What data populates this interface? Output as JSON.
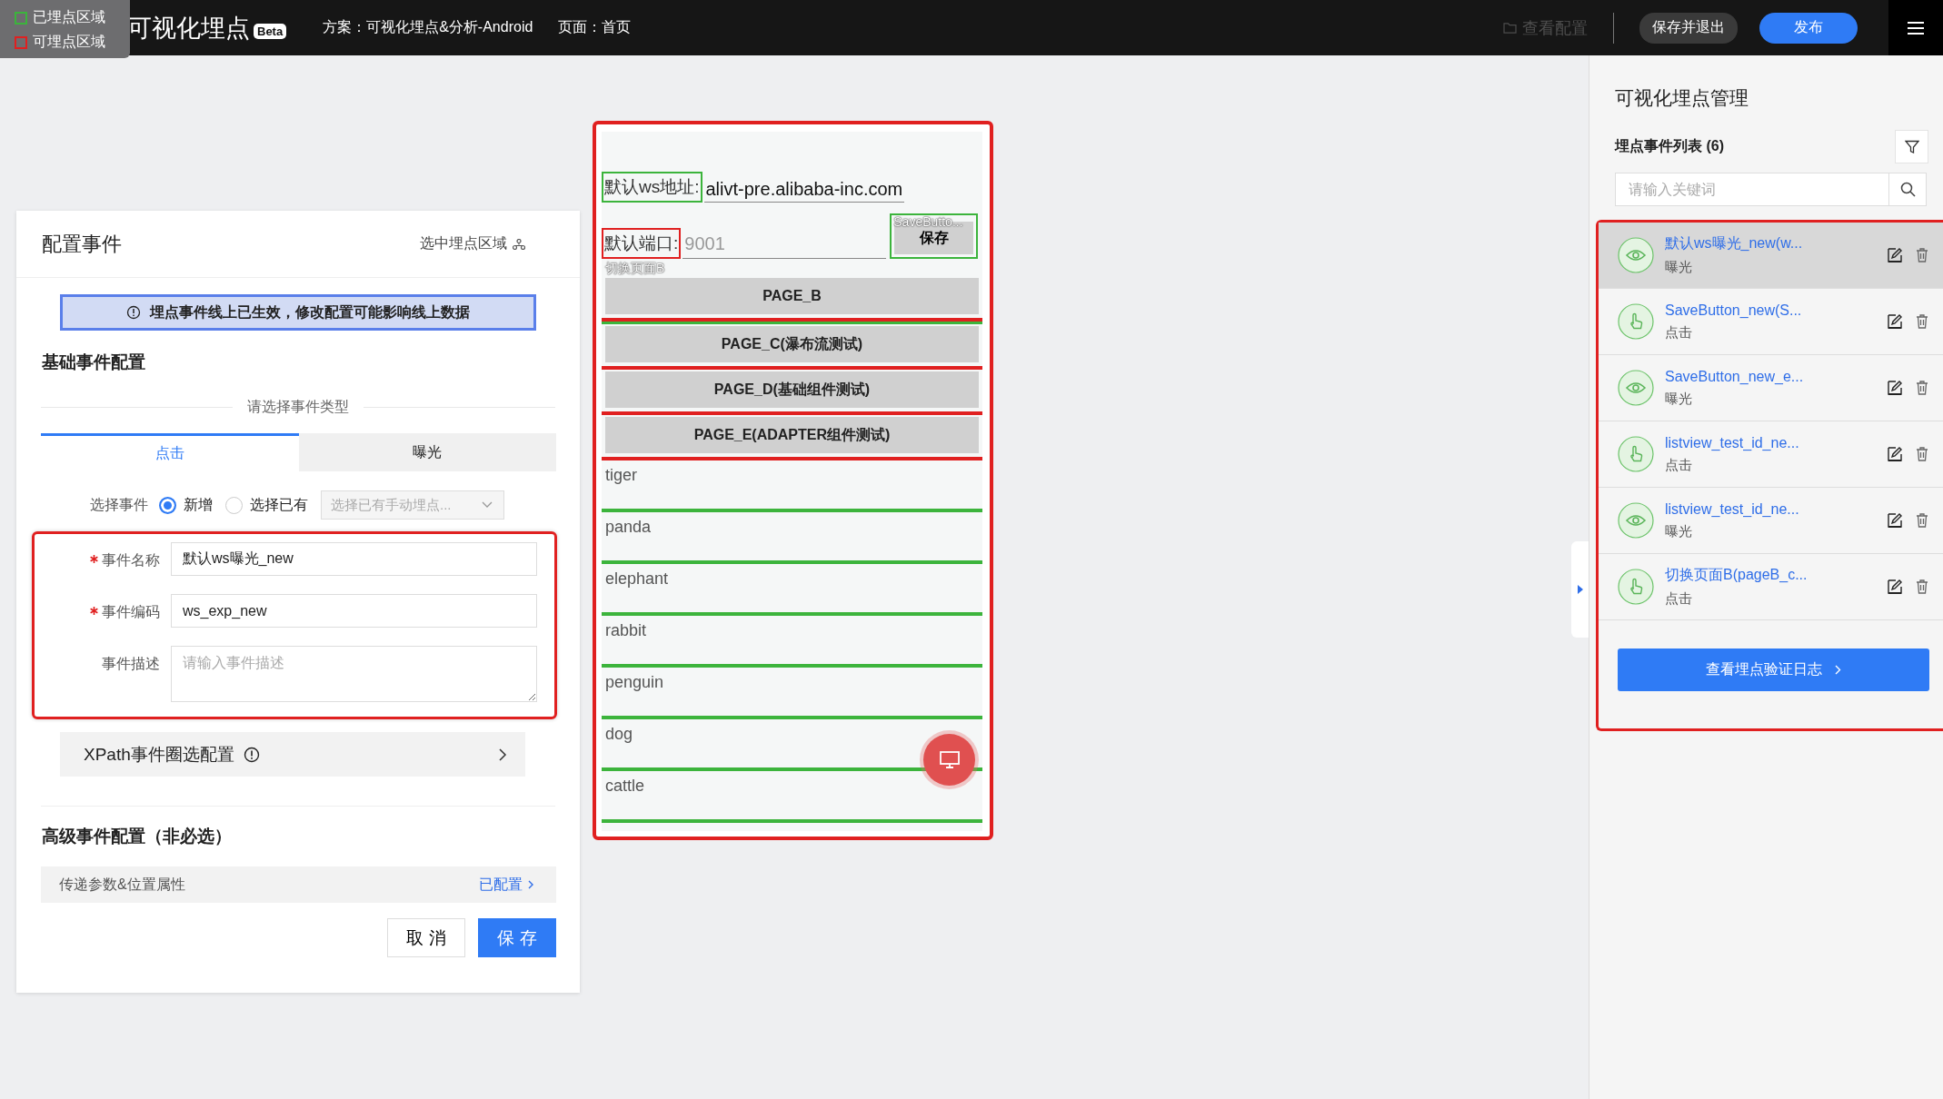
{
  "legend": [
    {
      "label": "已埋点区域",
      "color": "#3cb43c"
    },
    {
      "label": "可埋点区域",
      "color": "#e02020"
    }
  ],
  "topbar": {
    "title": "可视化埋点",
    "badge": "Beta",
    "plan": "方案：可视化埋点&分析-Android",
    "page": "页面：首页",
    "view_config": {
      "label": "查看配置",
      "disabled": true
    },
    "save_exit": "保存并退出",
    "publish": "发布"
  },
  "config_panel": {
    "title": "配置事件",
    "select_area": "选中埋点区域",
    "alert": "埋点事件线上已生效，修改配置可能影响线上数据",
    "basic_section": "基础事件配置",
    "type_divider": "请选择事件类型",
    "tabs": [
      {
        "label": "点击",
        "selected": true
      },
      {
        "label": "曝光",
        "selected": false
      }
    ],
    "select_event": {
      "label": "选择事件",
      "options": [
        {
          "label": "新增",
          "selected": true
        },
        {
          "label": "选择已有",
          "selected": false
        }
      ],
      "dropdown_placeholder": "选择已有手动埋点..."
    },
    "fields": [
      {
        "label": "事件名称",
        "required": true,
        "kind": "input",
        "value": "默认ws曝光_new"
      },
      {
        "label": "事件编码",
        "required": true,
        "kind": "input",
        "value": "ws_exp_new"
      },
      {
        "label": "事件描述",
        "required": false,
        "kind": "textarea",
        "placeholder": "请输入事件描述"
      }
    ],
    "xpath": "XPath事件圈选配置",
    "advanced_section": "高级事件配置（非必选）",
    "params": {
      "label": "传递参数&位置属性",
      "link": "已配置"
    },
    "buttons": {
      "cancel": "取 消",
      "save": "保 存"
    }
  },
  "phone": {
    "address": {
      "label": "默认ws地址:",
      "value": "alivt-pre.alibaba-inc.com",
      "tracked": true
    },
    "port": {
      "label": "默认端口:",
      "placeholder": "9001",
      "tracked": false
    },
    "save_button": {
      "label": "保存",
      "tag": "SaveButto..."
    },
    "page_tag": "切换页面B",
    "page_buttons": [
      {
        "label": "PAGE_B",
        "tracked": true
      },
      {
        "label": "PAGE_C(瀑布流测试)",
        "tracked": false
      },
      {
        "label": "PAGE_D(基础组件测试)",
        "tracked": false
      },
      {
        "label": "PAGE_E(ADAPTER组件测试)",
        "tracked": false
      }
    ],
    "list_items": [
      {
        "label": "tiger",
        "tracked": true
      },
      {
        "label": "panda",
        "tracked": true
      },
      {
        "label": "elephant",
        "tracked": true
      },
      {
        "label": "rabbit",
        "tracked": true
      },
      {
        "label": "penguin",
        "tracked": true
      },
      {
        "label": "dog",
        "tracked": true
      },
      {
        "label": "cattle",
        "tracked": true
      }
    ]
  },
  "manager": {
    "title": "可视化埋点管理",
    "list_title": "埋点事件列表 (6)",
    "search_placeholder": "请输入关键词",
    "events": [
      {
        "name": "默认ws曝光_new(w...",
        "type": "曝光",
        "kind": "exposure",
        "selected": true
      },
      {
        "name": "SaveButton_new(S...",
        "type": "点击",
        "kind": "click",
        "selected": false
      },
      {
        "name": "SaveButton_new_e...",
        "type": "曝光",
        "kind": "exposure",
        "selected": false
      },
      {
        "name": "listview_test_id_ne...",
        "type": "点击",
        "kind": "click",
        "selected": false
      },
      {
        "name": "listview_test_id_ne...",
        "type": "曝光",
        "kind": "exposure",
        "selected": false
      },
      {
        "name": "切换页面B(pageB_c...",
        "type": "点击",
        "kind": "click",
        "selected": false
      }
    ],
    "log_button": "查看埋点验证日志"
  }
}
